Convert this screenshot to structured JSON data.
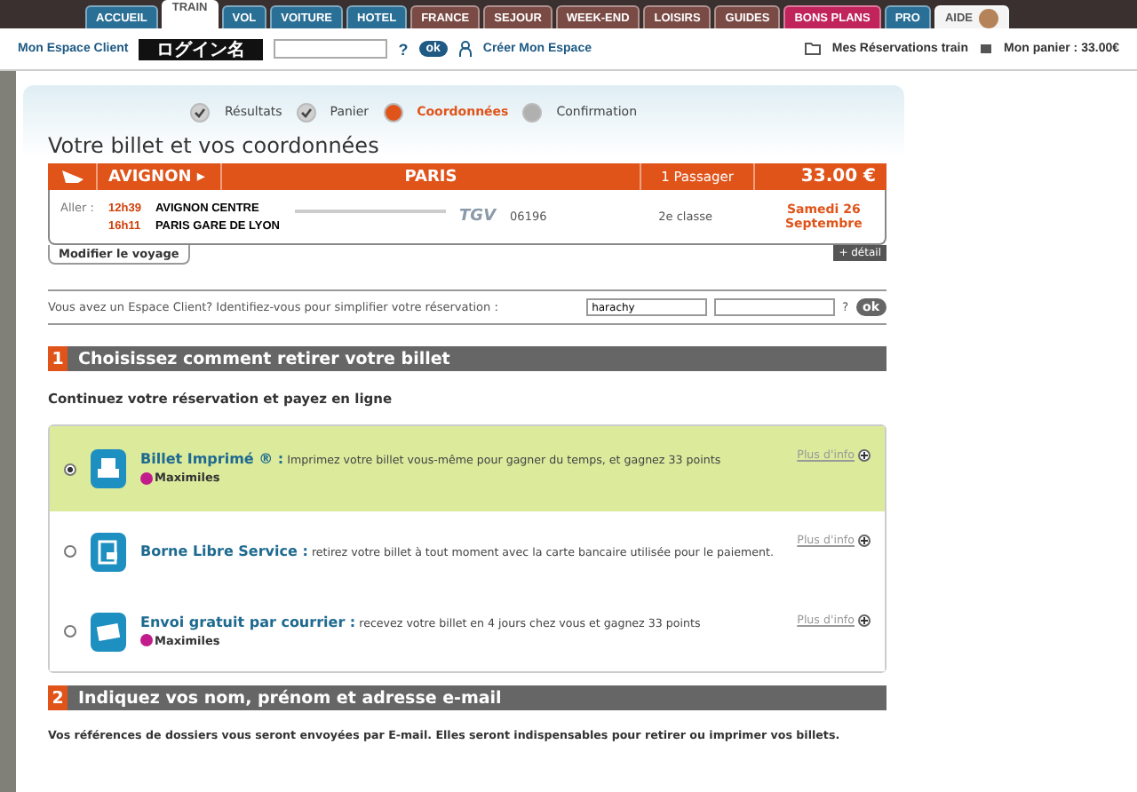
{
  "nav_tabs": [
    {
      "label": "ACCUEIL",
      "color": "#2a6f95",
      "selected": false
    },
    {
      "label": "TRAIN",
      "color": "#ffffff",
      "selected": true
    },
    {
      "label": "VOL",
      "color": "#2a6f95",
      "selected": false
    },
    {
      "label": "VOITURE",
      "color": "#2a6f95",
      "selected": false
    },
    {
      "label": "HOTEL",
      "color": "#2a6f95",
      "selected": false
    },
    {
      "label": "FRANCE",
      "color": "#7a4a45",
      "selected": false
    },
    {
      "label": "SEJOUR",
      "color": "#7a4a45",
      "selected": false
    },
    {
      "label": "WEEK-END",
      "color": "#7a4a45",
      "selected": false
    },
    {
      "label": "LOISIRS",
      "color": "#7a4a45",
      "selected": false
    },
    {
      "label": "GUIDES",
      "color": "#7a4a45",
      "selected": false
    },
    {
      "label": "BONS PLANS",
      "color": "#c0245a",
      "selected": false
    },
    {
      "label": "PRO",
      "color": "#2a6f95",
      "selected": false
    },
    {
      "label": "AIDE",
      "color": "#f4f4f4",
      "selected": false
    }
  ],
  "account_bar": {
    "label": "Mon Espace Client",
    "login_value": "ログイン名",
    "help": "?",
    "ok": "ok",
    "create": "Créer Mon Espace",
    "reservations": "Mes Réservations train",
    "basket": "Mon panier : 33.00€"
  },
  "steps": [
    {
      "label": "Résultats",
      "completed": true,
      "current": false
    },
    {
      "label": "Panier",
      "completed": true,
      "current": false
    },
    {
      "label": "Coordonnées",
      "completed": false,
      "current": true
    },
    {
      "label": "Confirmation",
      "completed": false,
      "current": false
    }
  ],
  "page_title": "Votre billet et vos coordonnées",
  "trip": {
    "from": "AVIGNON ▸",
    "to": "PARIS",
    "passengers": "1 Passager",
    "price": "33.00 €",
    "direction": "Aller :",
    "dep_time": "12h39",
    "dep_station": "AVIGNON CENTRE",
    "arr_time": "16h11",
    "arr_station": "PARIS GARE DE LYON",
    "train_brand": "TGV",
    "train_number": "06196",
    "class": "2e classe",
    "date": "Samedi 26 Septembre",
    "modify": "Modifier le voyage",
    "detail": "+ détail"
  },
  "login_row": {
    "prompt": "Vous avez un Espace Client? Identifiez-vous pour simplifier votre réservation :",
    "login_value": "harachy",
    "help": "?",
    "ok": "ok"
  },
  "section_1": {
    "number": "1",
    "title": "Choisissez comment retirer votre billet"
  },
  "subtitle": "Continuez votre réservation et payez en ligne",
  "options": [
    {
      "kind": "printer",
      "selected": true,
      "title": "Billet Imprimé ® :",
      "text": "Imprimez votre billet vous-même pour gagner du temps, et gagnez 33 points",
      "maximiles": "Maximiles",
      "more": "Plus d'info"
    },
    {
      "kind": "kiosk",
      "selected": false,
      "title": "Borne Libre Service :",
      "text": "retirez votre billet à tout moment avec la carte bancaire utilisée pour le paiement.",
      "more": "Plus d'info"
    },
    {
      "kind": "mail",
      "selected": false,
      "title": "Envoi gratuit par courrier :",
      "text": "recevez votre billet en 4 jours chez vous et gagnez 33 points",
      "maximiles": "Maximiles",
      "more": "Plus d'info"
    }
  ],
  "section_2": {
    "number": "2",
    "title": "Indiquez vos nom, prénom et adresse e-mail"
  },
  "footer_text": "Vos références de dossiers vous seront envoyées par E-mail. Elles seront indispensables pour retirer ou imprimer vos billets."
}
